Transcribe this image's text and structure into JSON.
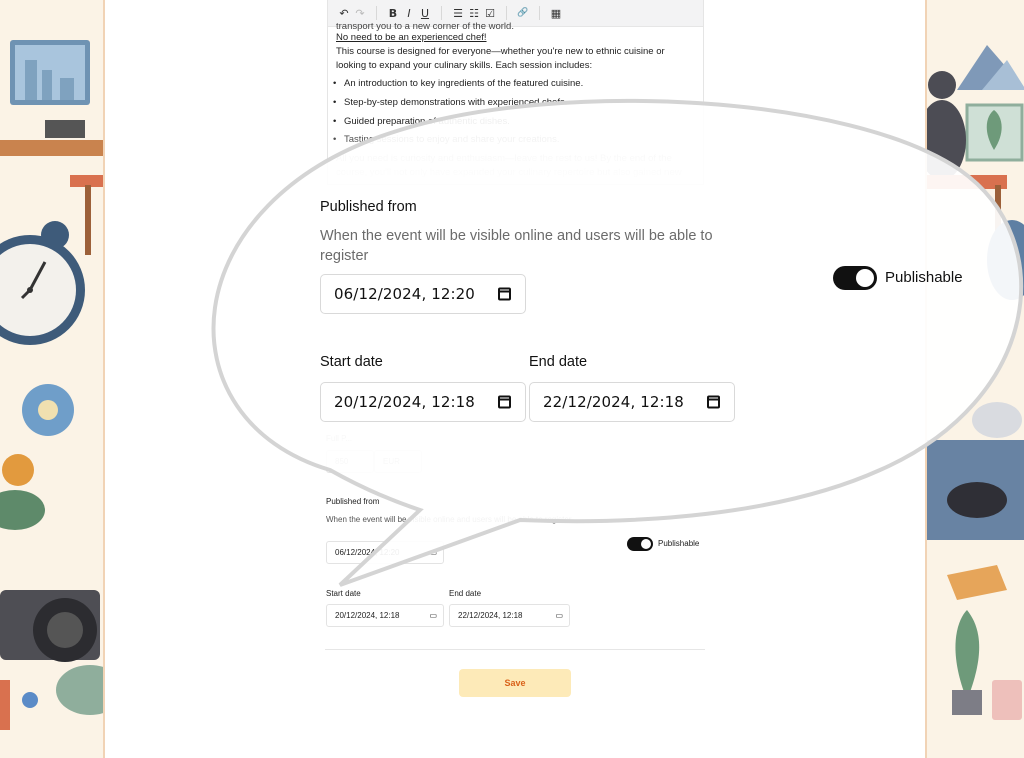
{
  "editor": {
    "toolbar": {
      "undo": "↶",
      "redo": "↷",
      "bold": "B",
      "italic": "I",
      "underline": "U",
      "bullet_list": "☰",
      "ordered_list": "☷",
      "task_list": "☑",
      "link": "🔗",
      "table": "▦"
    },
    "cut_line": "transport you to a new corner of the world.",
    "underlined": "No need to be an experienced chef!",
    "paragraph": "This course is designed for everyone—whether you're new to ethnic cuisine or looking to expand your culinary skills. Each session includes:",
    "bullets": [
      "An introduction to key ingredients of the featured cuisine.",
      "Step-by-step demonstrations with experienced chefs.",
      "Guided preparation of authentic dishes.",
      "Tasting sessions to enjoy and share your creations."
    ],
    "closing": "All you need is curiosity and enthusiasm—leave the rest to us! By the end of the course, you'll not only have expanded your culinary repertoire but also gained new"
  },
  "form": {
    "full_price_label": "Full P...",
    "price_value": "850",
    "currency": "EUR",
    "published_from_label": "Published from",
    "published_from_desc": "When the event will be visible online and users will be able to register",
    "published_from_value": "06/12/2024, 12:20",
    "publishable_label": "Publishable",
    "start_label": "Start date",
    "end_label": "End date",
    "start_value": "20/12/2024, 12:18",
    "end_value": "22/12/2024, 12:18",
    "save_label": "Save"
  },
  "zoom": {
    "published_from_label": "Published from",
    "published_from_desc": "When the event will be visible online and users will be able to register",
    "published_from_value": "06/12/2024, 12:20",
    "publishable_label": "Publishable",
    "start_label": "Start date",
    "end_label": "End date",
    "start_value": "20/12/2024, 12:18",
    "end_value": "22/12/2024, 12:18"
  },
  "colors": {
    "accent_bg": "#fdeab8",
    "accent_text": "#d9621a",
    "toggle_on": "#111111"
  }
}
